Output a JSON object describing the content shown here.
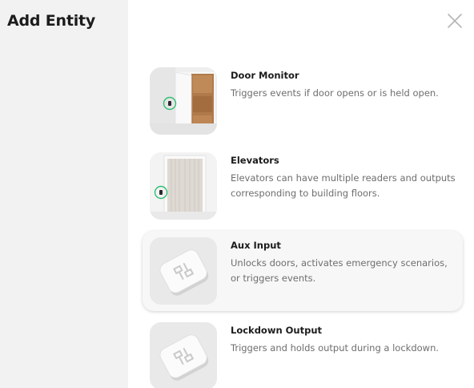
{
  "header": {
    "title": "Add Entity",
    "close_icon": "close-icon"
  },
  "entities": [
    {
      "name": "Door Monitor",
      "description": "Triggers events if door opens or is held open.",
      "icon": "door-monitor-icon"
    },
    {
      "name": "Elevators",
      "description": "Elevators can have multiple readers and outputs corresponding to building floors.",
      "icon": "elevator-icon"
    },
    {
      "name": "Aux Input",
      "description": "Unlocks doors, activates emergency scenarios, or triggers events.",
      "icon": "aux-input-device-icon",
      "selected": true
    },
    {
      "name": "Lockdown Output",
      "description": "Triggers and holds output during a lockdown.",
      "icon": "lockdown-output-device-icon"
    }
  ],
  "colors": {
    "sidebar_bg": "#f2f2f2",
    "reader_ring": "#2fbf71",
    "door_wood": "#b07a4a",
    "selected_bg": "#f7f7f7"
  }
}
